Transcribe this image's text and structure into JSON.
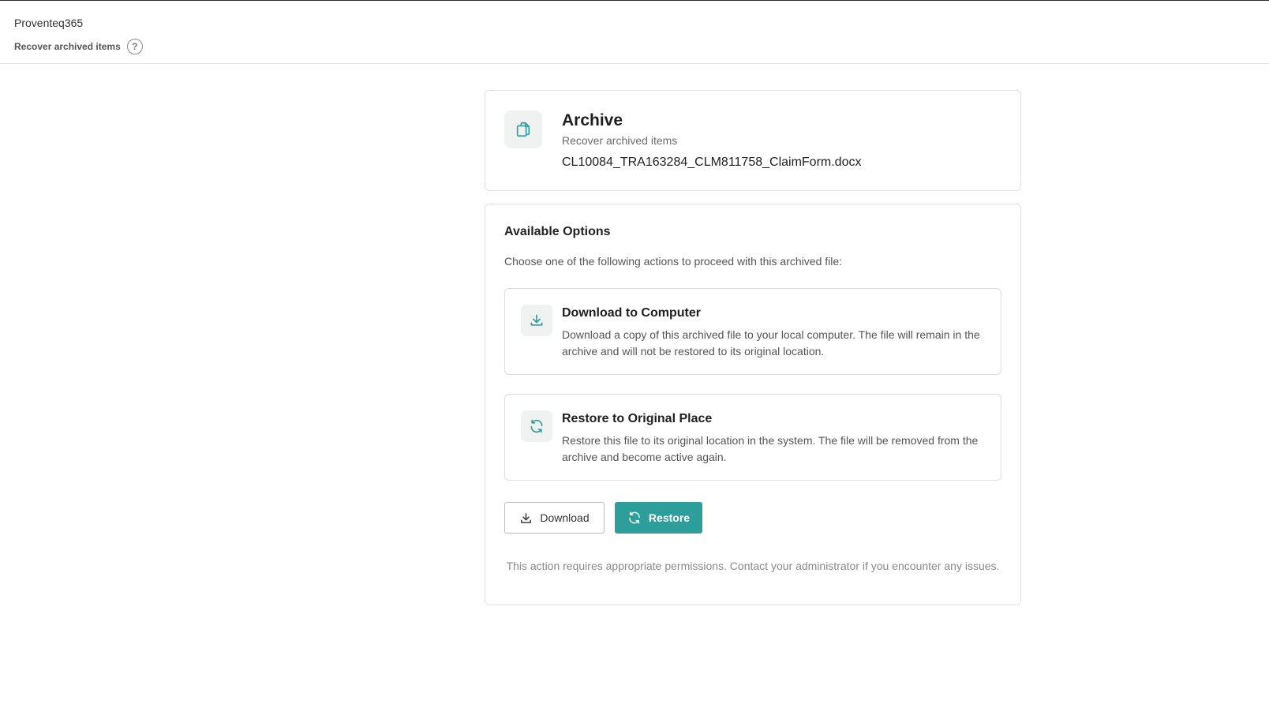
{
  "header": {
    "app_name": "Proventeq365",
    "subtitle": "Recover archived items",
    "help_glyph": "?"
  },
  "archive": {
    "icon": "copy-files-icon",
    "title": "Archive",
    "subtitle": "Recover archived items",
    "filename": "CL10084_TRA163284_CLM811758_ClaimForm.docx"
  },
  "options": {
    "heading": "Available Options",
    "description": "Choose one of the following actions to proceed with this archived file:",
    "items": [
      {
        "icon": "download-icon",
        "title": "Download to Computer",
        "description": "Download a copy of this archived file to your local computer. The file will remain in the archive and will not be restored to its original location."
      },
      {
        "icon": "refresh-icon",
        "title": "Restore to Original Place",
        "description": "Restore this file to its original location in the system. The file will be removed from the archive and become active again."
      }
    ],
    "buttons": {
      "download_label": "Download",
      "restore_label": "Restore"
    },
    "footer_note": "This action requires appropriate permissions. Contact your administrator if you encounter any issues."
  },
  "colors": {
    "accent": "#2e9e9a",
    "icon_tile_bg": "#f0f2f2",
    "border": "#e1e1e1"
  }
}
